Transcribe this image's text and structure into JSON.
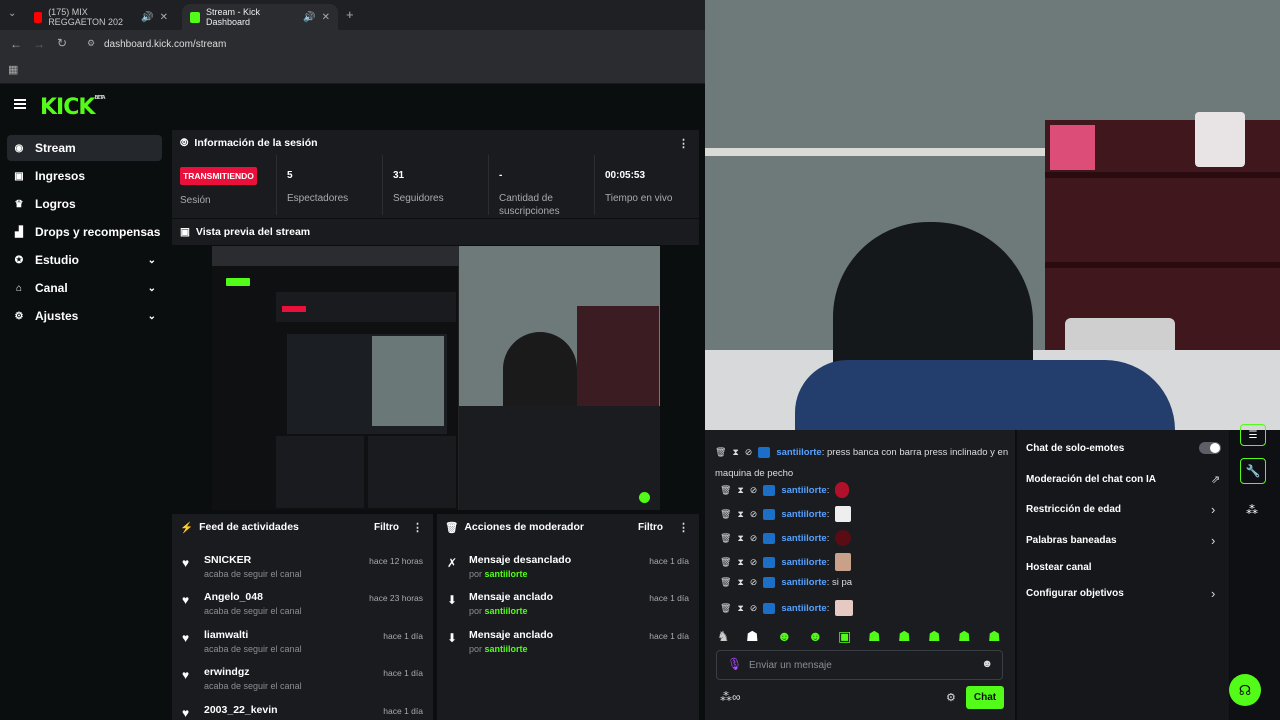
{
  "browser": {
    "tabs": [
      {
        "title": "(175) MIX REGGAETON 202",
        "favicon_color": "#ff0000"
      },
      {
        "title": "Stream - Kick Dashboard",
        "favicon_color": "#53fc18"
      }
    ],
    "url": "dashboard.kick.com/stream"
  },
  "brand": {
    "logo": "KICK",
    "beta": "BETA",
    "accent": "#53fc18"
  },
  "sidebar": {
    "items": [
      {
        "label": "Stream",
        "icon": "broadcast-icon"
      },
      {
        "label": "Ingresos",
        "icon": "dollar-icon"
      },
      {
        "label": "Logros",
        "icon": "trophy-icon"
      },
      {
        "label": "Drops y recompensas",
        "icon": "gift-icon"
      },
      {
        "label": "Estudio",
        "icon": "studio-icon"
      },
      {
        "label": "Canal",
        "icon": "channel-icon"
      },
      {
        "label": "Ajustes",
        "icon": "gear-icon"
      }
    ]
  },
  "session": {
    "title": "Información de la sesión",
    "status": "TRANSMITIENDO",
    "status_label": "Sesión",
    "viewers_value": "5",
    "viewers_label": "Espectadores",
    "followers_value": "31",
    "followers_label": "Seguidores",
    "subs_value": "-",
    "subs_label": "Cantidad de suscripciones",
    "live_value": "00:05:53",
    "live_label": "Tiempo en vivo"
  },
  "preview": {
    "title": "Vista previa del stream"
  },
  "activity": {
    "title": "Feed de actividades",
    "filter": "Filtro",
    "items": [
      {
        "name": "SNICKER",
        "sub": "acaba de seguir el canal",
        "time": "hace 12 horas"
      },
      {
        "name": "Angelo_048",
        "sub": "acaba de seguir el canal",
        "time": "hace 23 horas"
      },
      {
        "name": "liamwalti",
        "sub": "acaba de seguir el canal",
        "time": "hace 1 día"
      },
      {
        "name": "erwindgz",
        "sub": "acaba de seguir el canal",
        "time": "hace 1 día"
      },
      {
        "name": "2003_22_kevin",
        "sub": "",
        "time": "hace 1 día"
      }
    ]
  },
  "modactions": {
    "title": "Acciones de moderador",
    "filter": "Filtro",
    "items": [
      {
        "action": "Mensaje desanclado",
        "by": "por",
        "user": "santiilorte",
        "time": "hace 1 día"
      },
      {
        "action": "Mensaje anclado",
        "by": "por",
        "user": "santiilorte",
        "time": "hace 1 día"
      },
      {
        "action": "Mensaje anclado",
        "by": "por",
        "user": "santiilorte",
        "time": "hace 1 día"
      }
    ]
  },
  "chat": {
    "messages": [
      {
        "user": "santiilorte",
        "text": ": press banca con barra press inclinado y en",
        "text2": "maquina de pecho"
      },
      {
        "user": "santiilorte",
        "text": ":"
      },
      {
        "user": "santiilorte",
        "text": ":"
      },
      {
        "user": "santiilorte",
        "text": ":"
      },
      {
        "user": "santiilorte",
        "text": ":"
      },
      {
        "user": "santiilorte",
        "text": ": si pa"
      },
      {
        "user": "santiilorte",
        "text": ":"
      }
    ],
    "placeholder": "Enviar un mensaje",
    "send": "Chat"
  },
  "moderation": {
    "items": [
      {
        "label": "Chat de solo-emotes"
      },
      {
        "label": "Moderación del chat con IA"
      },
      {
        "label": "Restricción de edad"
      },
      {
        "label": "Palabras baneadas"
      },
      {
        "label": "Hostear canal"
      },
      {
        "label": "Configurar objetivos"
      }
    ]
  }
}
